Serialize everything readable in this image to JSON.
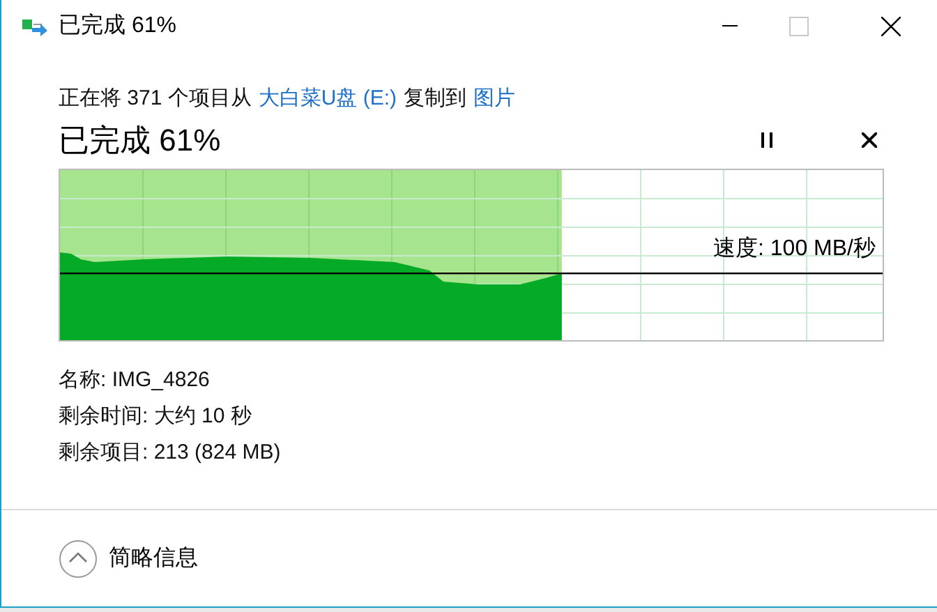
{
  "window": {
    "title": "已完成 61%"
  },
  "header": {
    "parts": [
      {
        "kind": "text",
        "text": "正在将 371 个项目从"
      },
      {
        "kind": "link",
        "text": "大白菜U盘 (E:)"
      },
      {
        "kind": "text",
        "text": "复制到"
      },
      {
        "kind": "link",
        "text": "图片"
      }
    ]
  },
  "progress": {
    "title": "已完成 61%",
    "level": 0.61,
    "speed": "速度: 100 MB/秒"
  },
  "details": [
    "名称: IMG_4826",
    "剩余时间: 大约 10 秒",
    "剩余项目: 213 (824 MB)"
  ],
  "footer": {
    "toggle": "简略信息",
    "expanded": true
  }
}
